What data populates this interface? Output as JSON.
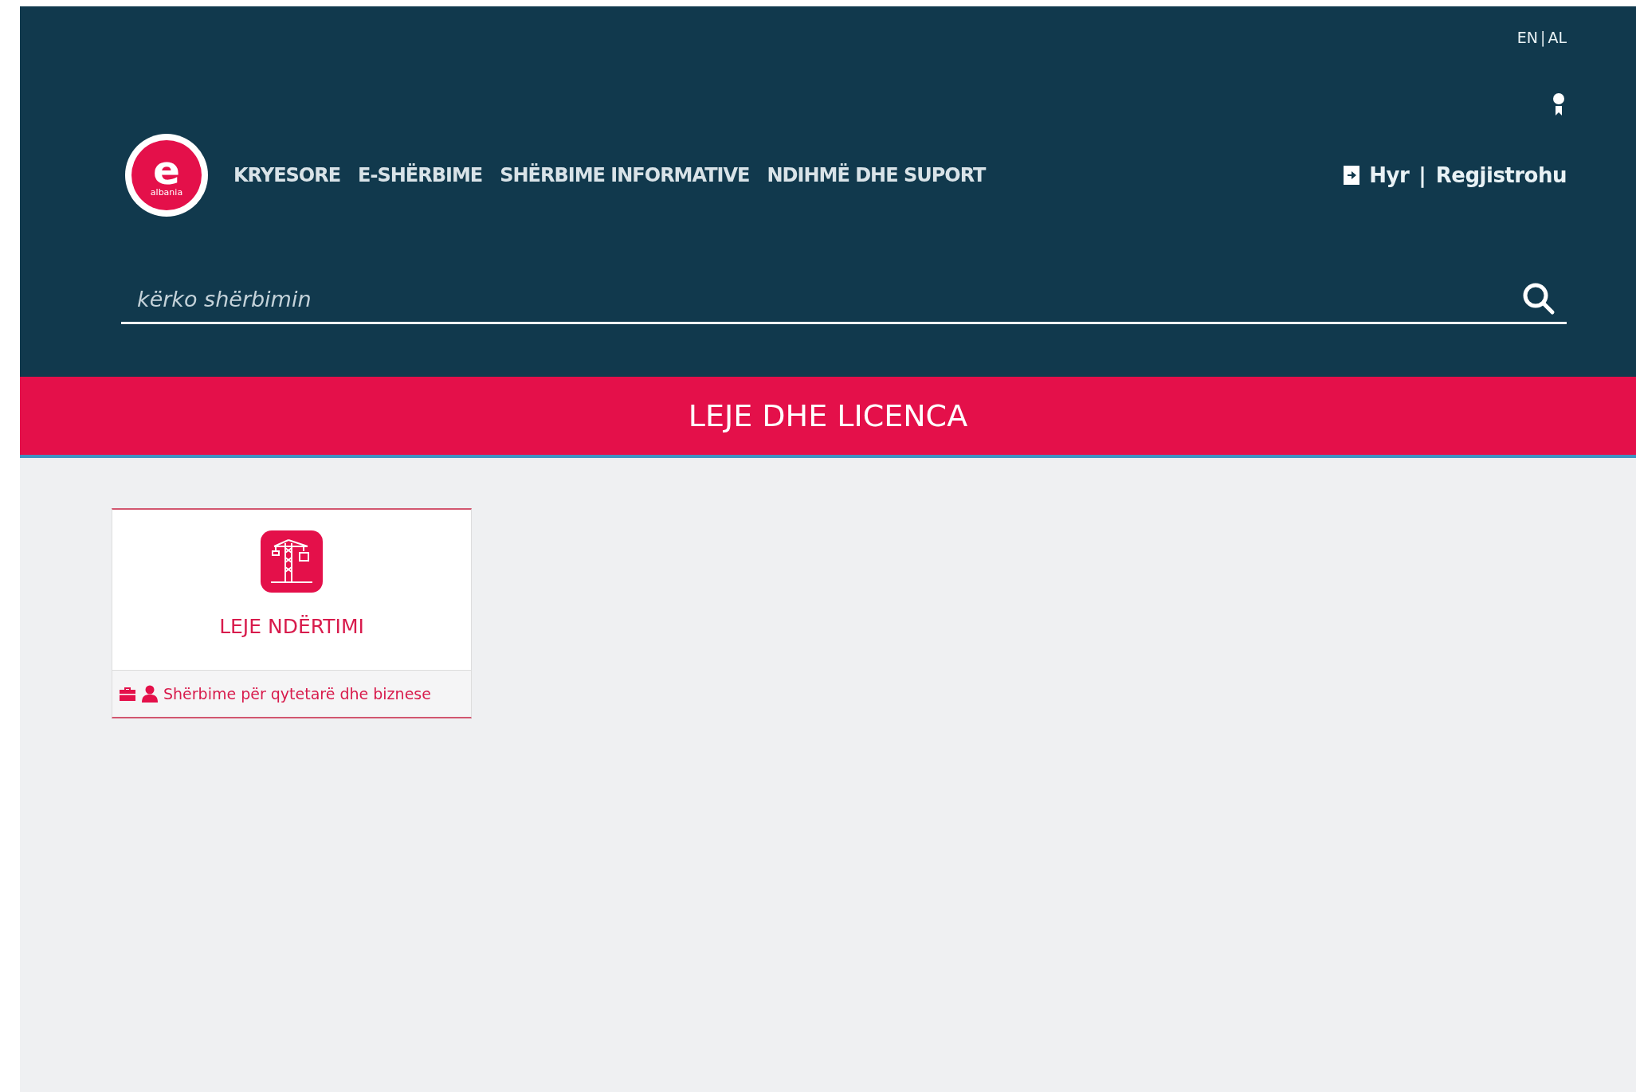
{
  "language_switch": {
    "options": [
      "EN",
      "AL"
    ],
    "separator": "|"
  },
  "logo": {
    "letter": "e",
    "caption": "albania"
  },
  "nav": {
    "items": [
      "KRYESORE",
      "E-SHËRBIME",
      "SHËRBIME INFORMATIVE",
      "NDIHMË DHE SUPORT"
    ]
  },
  "auth": {
    "login": "Hyr",
    "separator": "|",
    "register": "Regjistrohu"
  },
  "search": {
    "placeholder": "kërko shërbimin"
  },
  "banner": {
    "title": "LEJE DHE LICENCA"
  },
  "cards": [
    {
      "title": "LEJE NDËRTIMI",
      "footer": "Shërbime për qytetarë dhe biznese"
    }
  ]
}
